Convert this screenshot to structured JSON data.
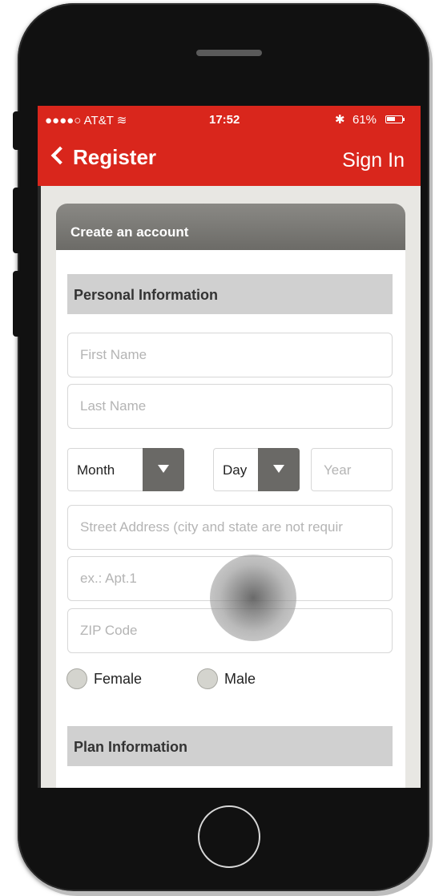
{
  "status_bar": {
    "carrier": "●●●●○ AT&T ≋",
    "time": "17:52",
    "bluetooth_icon": "bluetooth-icon",
    "battery": "61%",
    "battery_level": 0.61
  },
  "nav": {
    "back_label": "Register",
    "sign_in_label": "Sign In"
  },
  "card": {
    "title": "Create an account"
  },
  "personal_section": {
    "title": "Personal Information",
    "first_name_placeholder": "First Name",
    "last_name_placeholder": "Last Name",
    "month_label": "Month",
    "day_label": "Day",
    "year_placeholder": "Year",
    "street_placeholder": "Street Address (city and state are not requir",
    "apt_placeholder": "ex.: Apt.1",
    "zip_placeholder": "ZIP Code",
    "gender_options": [
      "Female",
      "Male"
    ]
  },
  "plan_section": {
    "title": "Plan Information"
  },
  "colors": {
    "brand_red": "#d9261c",
    "header_gray": "#787773",
    "section_gray": "#d0d0d0"
  }
}
